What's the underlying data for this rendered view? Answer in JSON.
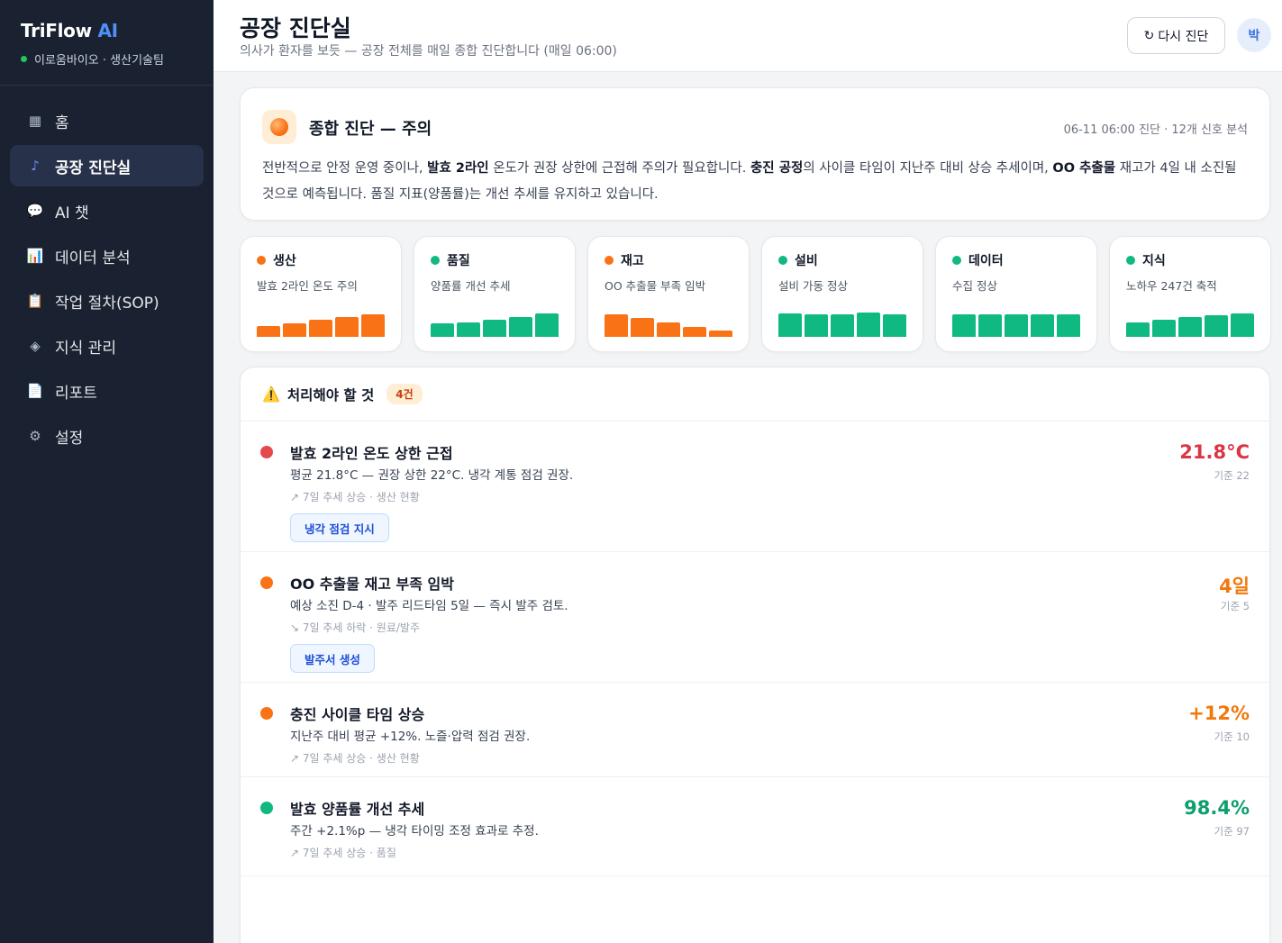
{
  "brand": {
    "name": "TriFlow",
    "ai": "AI",
    "org": "이로움바이오 · 생산기술팀"
  },
  "nav": [
    {
      "icon": "▦",
      "label": "홈",
      "active": false
    },
    {
      "icon": "♪",
      "label": "공장 진단실",
      "active": true
    },
    {
      "icon": "💬",
      "label": "AI 챗",
      "active": false
    },
    {
      "icon": "📊",
      "label": "데이터 분석",
      "active": false
    },
    {
      "icon": "📋",
      "label": "작업 절차(SOP)",
      "active": false
    },
    {
      "icon": "◈",
      "label": "지식 관리",
      "active": false
    },
    {
      "icon": "📄",
      "label": "리포트",
      "active": false
    },
    {
      "icon": "⚙",
      "label": "설정",
      "active": false
    }
  ],
  "header": {
    "title": "공장 진단실",
    "subtitle": "의사가 환자를 보듯 — 공장 전체를 매일 종합 진단합니다 (매일 06:00)",
    "refresh_icon": "↻",
    "refresh_label": "다시 진단",
    "avatar": "박"
  },
  "summary": {
    "title": "종합 진단 — 주의",
    "meta": "06-11 06:00 진단 · 12개 신호 분석",
    "parts": [
      {
        "t": "전반적으로 안정 운영 중이나, ",
        "b": false
      },
      {
        "t": "발효 2라인",
        "b": true
      },
      {
        "t": " 온도가 권장 상한에 근접해 주의가 필요합니다. ",
        "b": false
      },
      {
        "t": "충진 공정",
        "b": true
      },
      {
        "t": "의 사이클 타임이 지난주 대비 상승 추세이며, ",
        "b": false
      },
      {
        "t": "OO 추출물",
        "b": true
      },
      {
        "t": " 재고가 4일 내 소진될 것으로 예측됩니다. 품질 지표(양품률)는 개선 추세를 유지하고 있습니다.",
        "b": false
      }
    ]
  },
  "categories": [
    {
      "name": "생산",
      "desc": "발효 2라인 온도 주의",
      "color": "#f97316",
      "bars": [
        0.4,
        0.5,
        0.62,
        0.72,
        0.82
      ]
    },
    {
      "name": "품질",
      "desc": "양품률 개선 추세",
      "color": "#10b981",
      "bars": [
        0.5,
        0.55,
        0.65,
        0.75,
        0.88
      ]
    },
    {
      "name": "재고",
      "desc": "OO 추출물 부족 임박",
      "color": "#f97316",
      "bars": [
        0.85,
        0.7,
        0.52,
        0.38,
        0.25
      ]
    },
    {
      "name": "설비",
      "desc": "설비 가동 정상",
      "color": "#10b981",
      "bars": [
        0.88,
        0.85,
        0.85,
        0.9,
        0.85
      ]
    },
    {
      "name": "데이터",
      "desc": "수집 정상",
      "color": "#10b981",
      "bars": [
        0.82,
        0.85,
        0.85,
        0.85,
        0.85
      ]
    },
    {
      "name": "지식",
      "desc": "노하우 247건 축적",
      "color": "#10b981",
      "bars": [
        0.55,
        0.62,
        0.72,
        0.8,
        0.88
      ]
    }
  ],
  "todo": {
    "icon": "⚠️",
    "title": "처리해야 할 것",
    "count": "4건",
    "items": [
      {
        "color": "#e5484d",
        "title": "발효 2라인 온도 상한 근접",
        "desc": "평균 21.8°C — 권장 상한 22°C. 냉각 계통 점검 권장.",
        "trend": "↗ 7일 추세 상승 · 생산 현황",
        "action": "냉각 점검 지시",
        "value": "21.8°C",
        "value_color": "#dc3545",
        "base": "기준 22"
      },
      {
        "color": "#f97316",
        "title": "OO 추출물 재고 부족 임박",
        "desc": "예상 소진 D-4 · 발주 리드타임 5일 — 즉시 발주 검토.",
        "trend": "↘ 7일 추세 하락 · 원료/발주",
        "action": "발주서 생성",
        "value": "4일",
        "value_color": "#f2780c",
        "base": "기준 5"
      },
      {
        "color": "#f97316",
        "title": "충진 사이클 타임 상승",
        "desc": "지난주 대비 평균 +12%. 노즐·압력 점검 권장.",
        "trend": "↗ 7일 추세 상승 · 생산 현황",
        "action": "",
        "value": "+12%",
        "value_color": "#f2780c",
        "base": "기준 10"
      },
      {
        "color": "#10b981",
        "title": "발효 양품률 개선 추세",
        "desc": "주간 +2.1%p — 냉각 타이밍 조정 효과로 추정.",
        "trend": "↗ 7일 추세 상승 · 품질",
        "action": "",
        "value": "98.4%",
        "value_color": "#0e9f6e",
        "base": "기준 97"
      }
    ]
  }
}
